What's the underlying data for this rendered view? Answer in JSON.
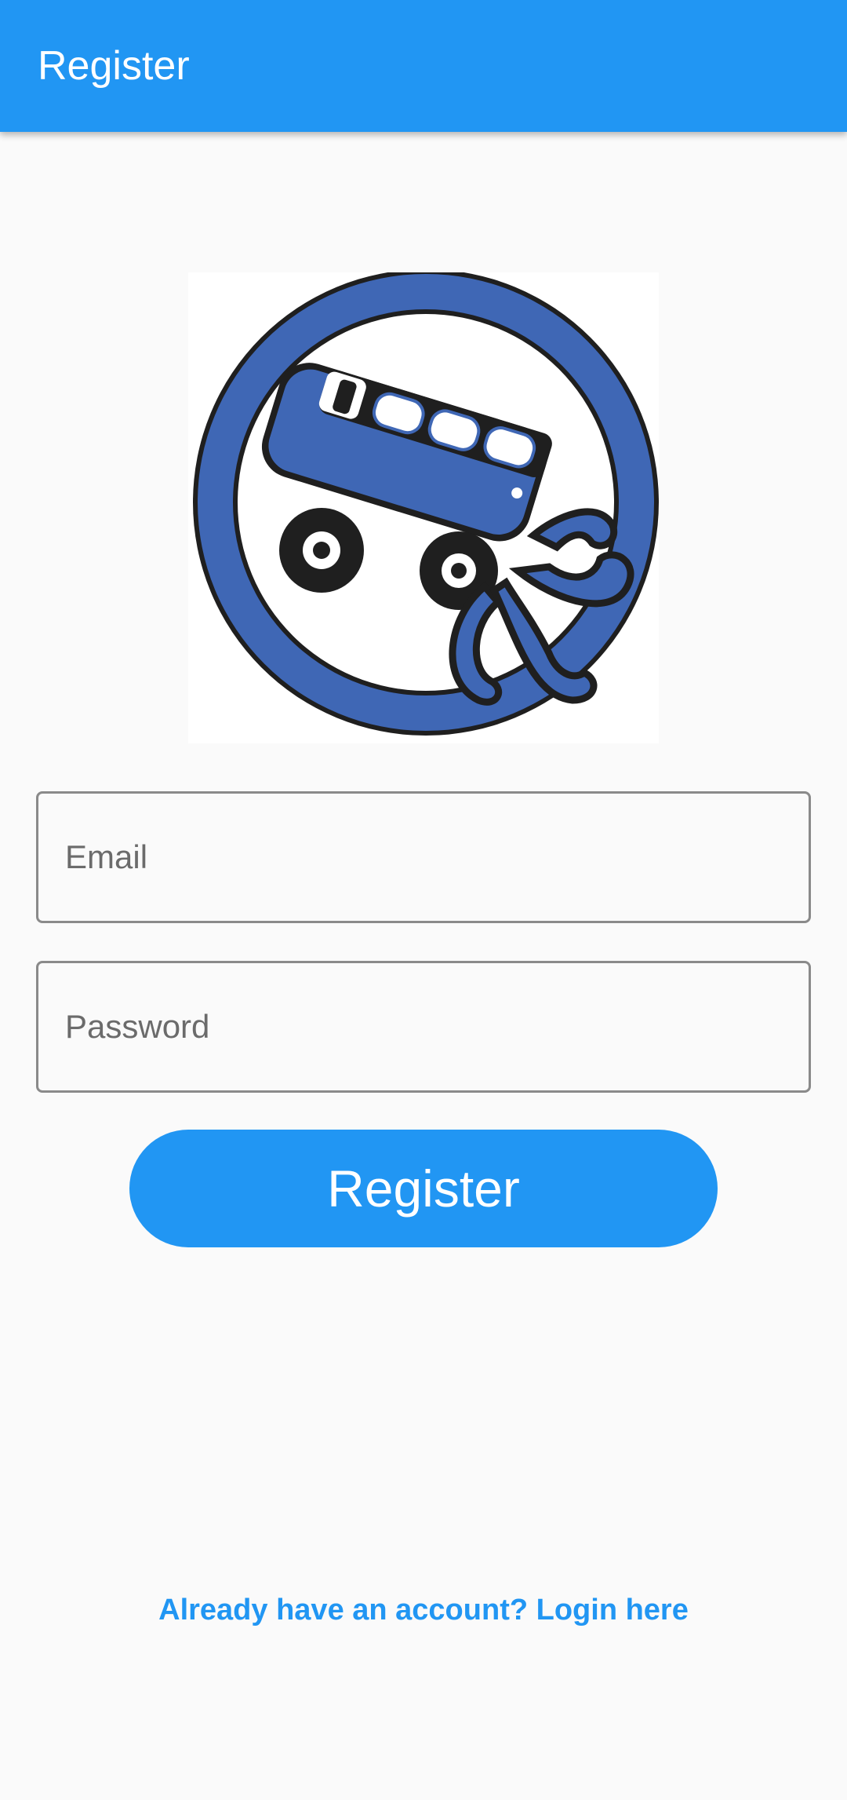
{
  "app_bar": {
    "title": "Register",
    "color": "#2196f3"
  },
  "logo": {
    "icon": "bus-octopus-logo",
    "ring_color": "#3f67b5"
  },
  "form": {
    "email_placeholder": "Email",
    "password_placeholder": "Password",
    "register_label": "Register"
  },
  "footer": {
    "login_link": "Already have an account? Login here"
  }
}
